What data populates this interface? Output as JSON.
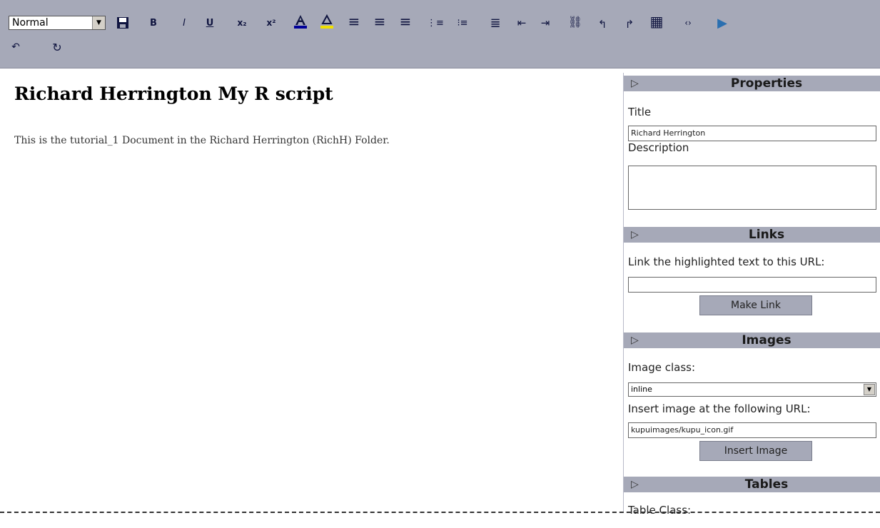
{
  "toolbar": {
    "style_select": {
      "value": "Normal"
    },
    "buttons": [
      {
        "name": "save-icon",
        "glyph": ""
      },
      {
        "name": "bold-icon",
        "glyph": "B"
      },
      {
        "name": "italic-icon",
        "glyph": "I"
      },
      {
        "name": "underline-icon",
        "glyph": "U"
      },
      {
        "name": "subscript-icon",
        "glyph": "x₂"
      },
      {
        "name": "superscript-icon",
        "glyph": "x²"
      },
      {
        "name": "text-color-icon",
        "glyph": "A"
      },
      {
        "name": "highlight-icon",
        "glyph": "A"
      },
      {
        "name": "align-left-icon",
        "glyph": "≡"
      },
      {
        "name": "align-center-icon",
        "glyph": "≡"
      },
      {
        "name": "align-right-icon",
        "glyph": "≡"
      },
      {
        "name": "ordered-list-icon",
        "glyph": "⋮≡"
      },
      {
        "name": "unordered-list-icon",
        "glyph": "⁝≡"
      },
      {
        "name": "definition-list-icon",
        "glyph": "≣"
      },
      {
        "name": "outdent-icon",
        "glyph": "⇤"
      },
      {
        "name": "indent-icon",
        "glyph": "⇥"
      },
      {
        "name": "link-icon",
        "glyph": "⛓"
      },
      {
        "name": "anchor-icon",
        "glyph": "↰"
      },
      {
        "name": "unlink-icon",
        "glyph": "↱"
      },
      {
        "name": "table-icon",
        "glyph": "▦"
      },
      {
        "name": "source-icon",
        "glyph": "‹›"
      },
      {
        "name": "toggle-sidebar-icon",
        "glyph": "▶"
      }
    ],
    "row2": [
      {
        "name": "undo-icon",
        "glyph": "↶"
      },
      {
        "name": "refresh-icon",
        "glyph": "↻"
      }
    ],
    "colors": {
      "background": "#a6a9b8",
      "icon": "#101540",
      "text_color_accent": "#000099",
      "highlight_accent": "#f0e000"
    }
  },
  "document": {
    "title": "Richard Herrington My R script",
    "paragraph": "This is the tutorial_1 Document in the Richard Herrington (RichH) Folder."
  },
  "sidepanel": {
    "properties": {
      "heading": "Properties",
      "title_label": "Title",
      "title_value": "Richard Herrington",
      "description_label": "Description",
      "description_value": ""
    },
    "links": {
      "heading": "Links",
      "prompt": "Link the highlighted text to this URL:",
      "url_value": "",
      "button": "Make Link"
    },
    "images": {
      "heading": "Images",
      "class_label": "Image class:",
      "class_value": "inline",
      "url_label": "Insert image at the following URL:",
      "url_value": "kupuimages/kupu_icon.gif",
      "button": "Insert Image"
    },
    "tables": {
      "heading": "Tables",
      "class_label": "Table Class:"
    },
    "toggle_glyph": "▷"
  }
}
